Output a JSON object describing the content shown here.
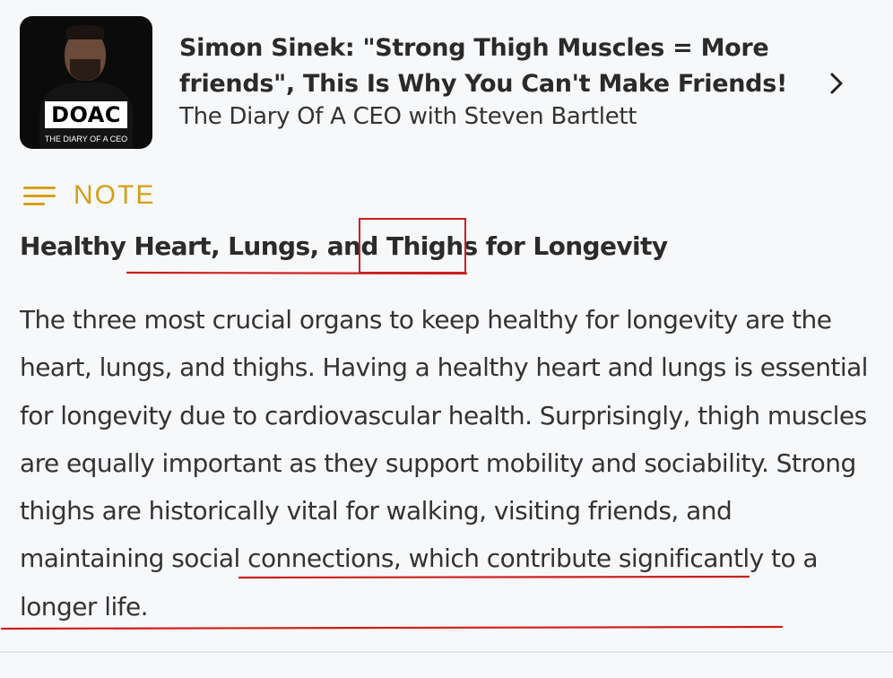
{
  "episode": {
    "title": "Simon Sinek: \"Strong Thigh Muscles = More friends\", This Is Why You Can't Make Friends!",
    "podcast": "The Diary Of A CEO with Steven Bartlett",
    "cover": {
      "logo": "DOAC",
      "subtitle": "THE DIARY OF A CEO"
    },
    "chevron_icon": "chevron-right-icon"
  },
  "note": {
    "label": "NOTE",
    "icon": "lines-icon",
    "accent_color": "#d4a017",
    "heading": "Healthy Heart, Lungs, and Thighs for Longevity",
    "body": "The three most crucial organs to keep healthy for longevity are the heart, lungs, and thighs. Having a healthy heart and lungs is essential for longevity due to cardiovascular health. Surprisingly, thigh muscles are equally important as they support mobility and sociability. Strong thighs are historically vital for walking, visiting friends, and maintaining social connections, which contribute significantly to a longer life."
  },
  "annotations": {
    "color": "#cc1f1f",
    "boxed_word": "Thighs",
    "underlined": [
      "Heart, Lungs, and Thighs",
      "visiting friends, and maintaining social connections, which contribute significantly to a longer life"
    ]
  }
}
